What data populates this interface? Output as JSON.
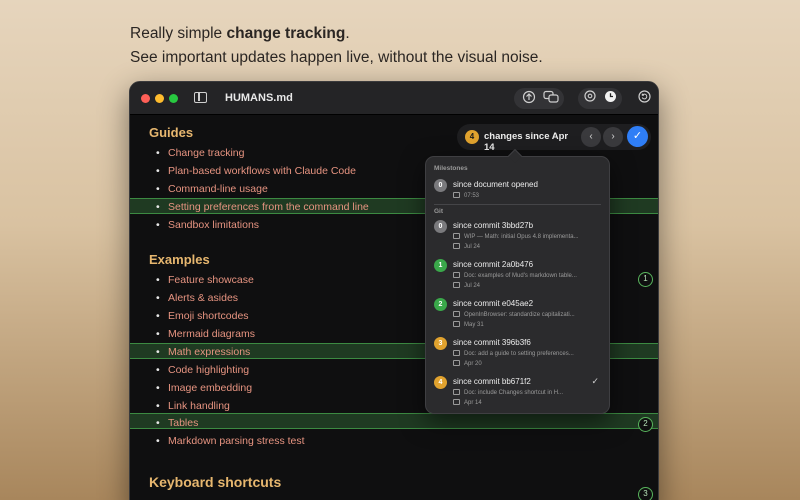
{
  "hero": {
    "line1_prefix": "Really simple ",
    "line1_bold": "change tracking",
    "line1_suffix": ".",
    "line2": "See important updates happen live, without the visual noise."
  },
  "window": {
    "title": "HUMANS.md"
  },
  "changes_pill": {
    "count": "4",
    "label": "changes since Apr 14",
    "prev_icon": "‹",
    "next_icon": "›",
    "confirm_icon": "✓"
  },
  "document": {
    "sections": [
      {
        "heading": "Guides",
        "items": [
          "Change tracking",
          "Plan-based workflows with Claude Code",
          "Command-line usage",
          "Setting preferences from the command line",
          "Sandbox limitations"
        ]
      },
      {
        "heading": "Examples",
        "items": [
          "Feature showcase",
          "Alerts & asides",
          "Emoji shortcodes",
          "Mermaid diagrams",
          "Math expressions",
          "Code highlighting",
          "Image embedding",
          "Link handling",
          "Tables",
          "Markdown parsing stress test"
        ]
      },
      {
        "heading": "Keyboard shortcuts",
        "items": []
      }
    ],
    "change_markers": [
      "1",
      "2",
      "3"
    ]
  },
  "popover": {
    "milestones_label": "Milestones",
    "git_label": "Git",
    "milestones": [
      {
        "badge": "0",
        "badge_color": "#7a7a7d",
        "title": "since document opened",
        "time": "07:53"
      }
    ],
    "commits": [
      {
        "badge": "0",
        "badge_color": "#7a7a7d",
        "title": "since commit 3bbd27b",
        "message": "WIP — Math: initial Opus 4.8 implementa...",
        "date": "Jul 24"
      },
      {
        "badge": "1",
        "badge_color": "#3aa84a",
        "title": "since commit 2a0b476",
        "message": "Doc: examples of Mud's markdown table...",
        "date": "Jul 24"
      },
      {
        "badge": "2",
        "badge_color": "#3aa84a",
        "title": "since commit e045ae2",
        "message": "OpenInBrowser: standardize capitalizati...",
        "date": "May 31"
      },
      {
        "badge": "3",
        "badge_color": "#e0a22e",
        "title": "since commit 396b3f6",
        "message": "Doc: add a guide to setting preferences...",
        "date": "Apr 20"
      },
      {
        "badge": "4",
        "badge_color": "#e0a22e",
        "title": "since commit bb671f2",
        "message": "Doc: include Changes shortcut in H...",
        "date": "Apr 14",
        "selected": true
      }
    ]
  }
}
